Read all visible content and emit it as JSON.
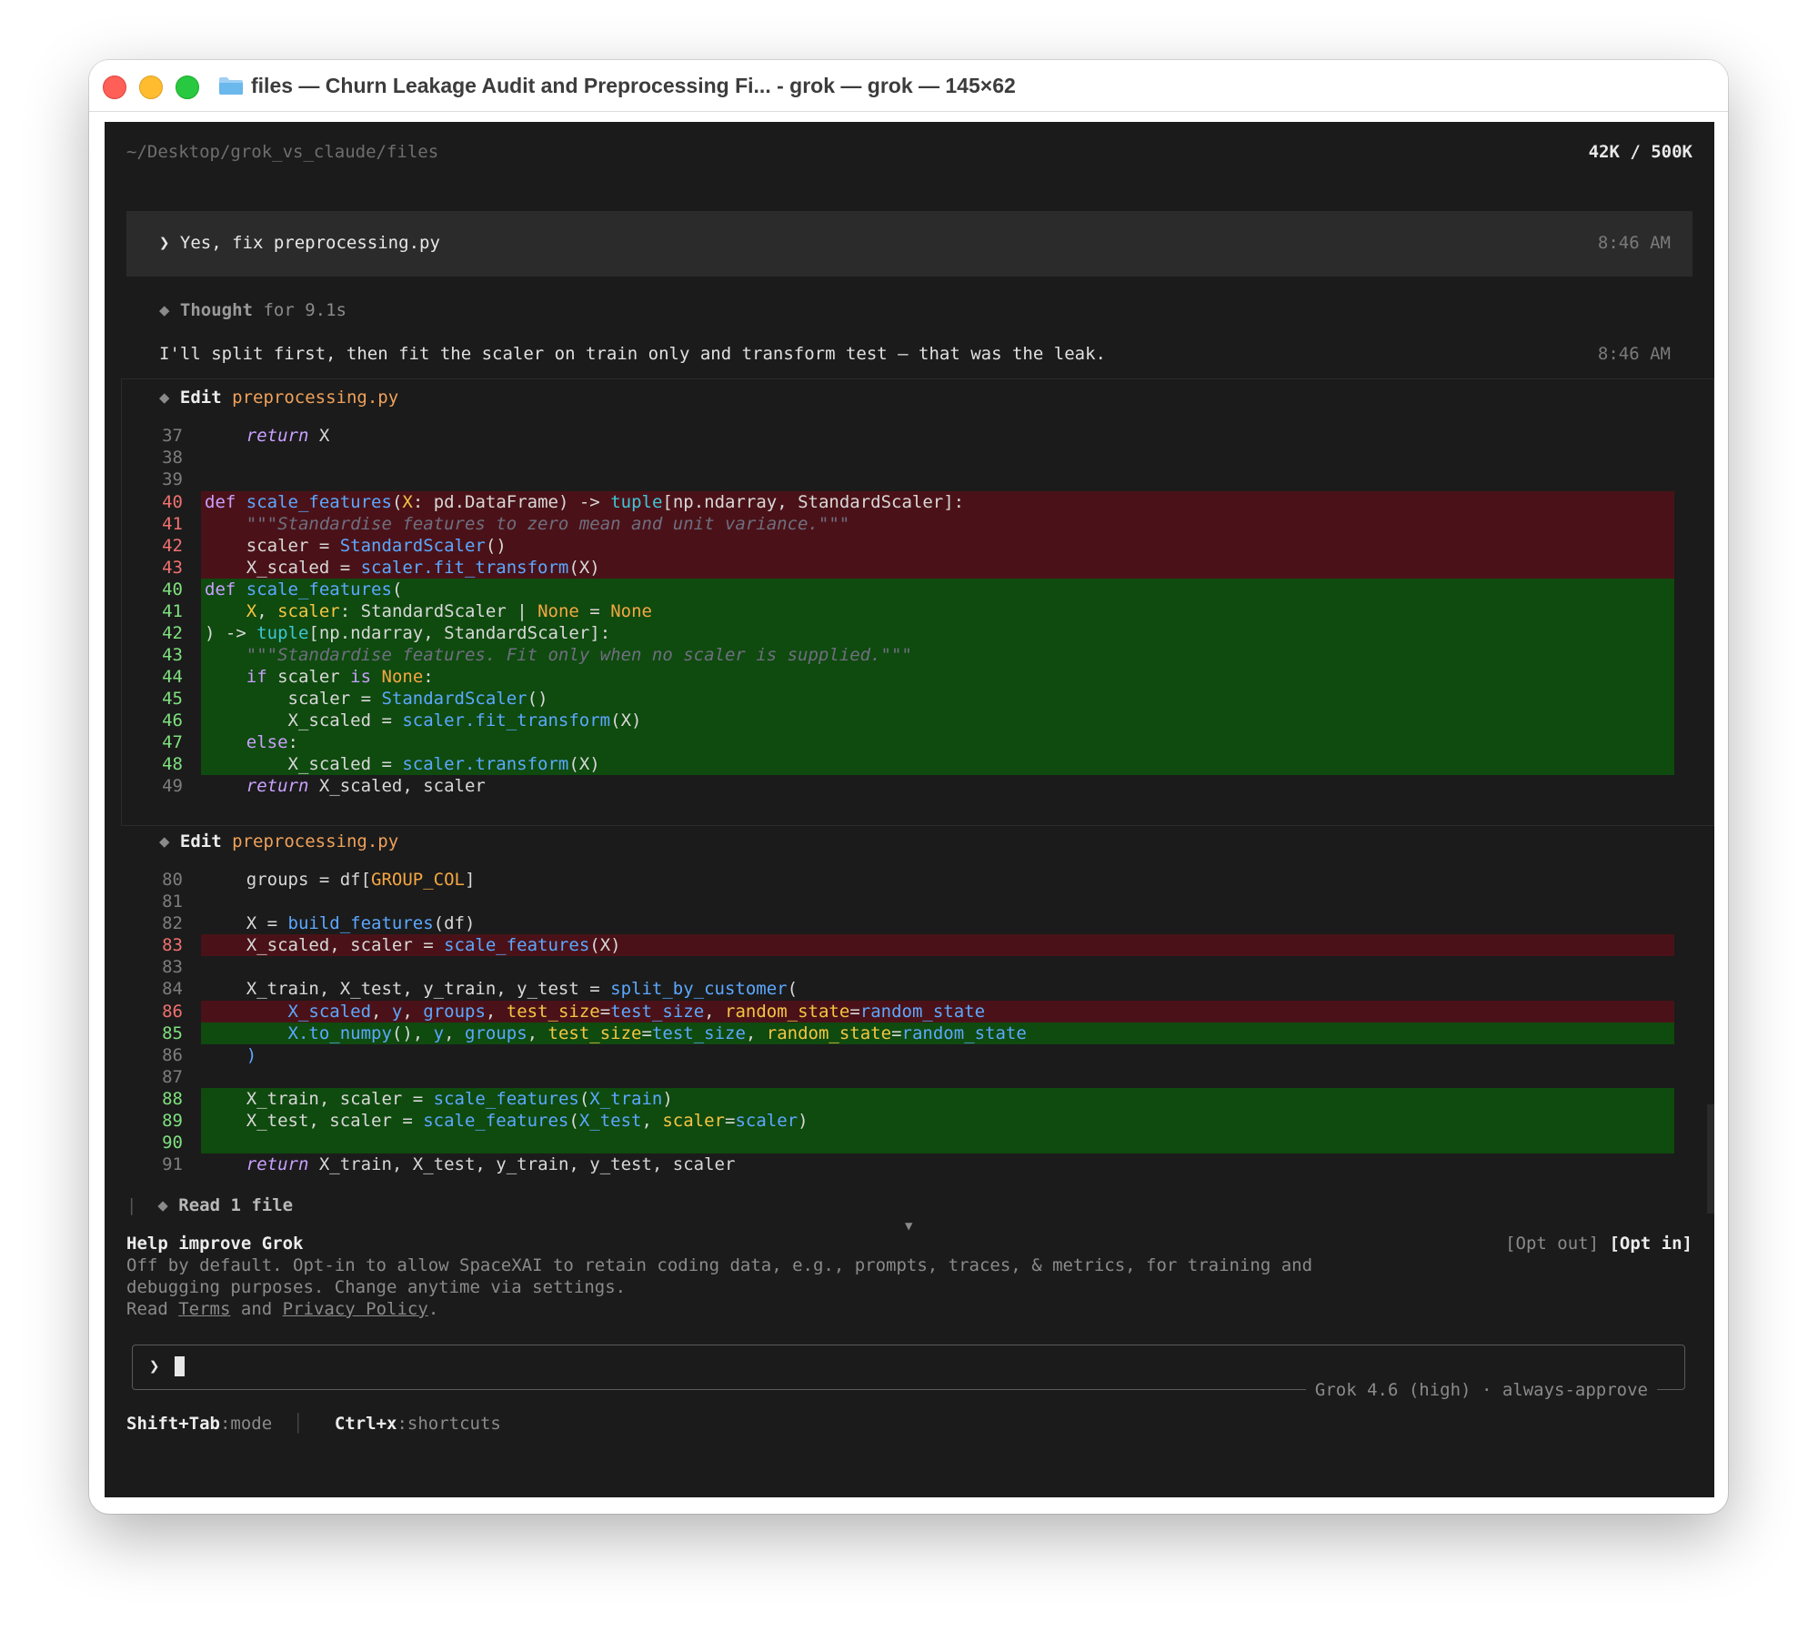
{
  "window": {
    "title": "files — Churn Leakage Audit and Preprocessing Fi... - grok — grok — 145×62"
  },
  "terminal": {
    "cwd": "~/Desktop/grok_vs_claude/files",
    "context_usage": "42K / 500K",
    "user_prompt": {
      "chevron": "❯",
      "text": "Yes, fix preprocessing.py",
      "time": "8:46 AM"
    },
    "thought": {
      "label": "Thought",
      "duration": "for 9.1s"
    },
    "assistant_message": {
      "text": "I'll split first, then fit the scaler on train only and transform test — that was the leak.",
      "time": "8:46 AM"
    },
    "edits": [
      {
        "action": "Edit",
        "file": "preprocessing.py"
      },
      {
        "action": "Edit",
        "file": "preprocessing.py"
      }
    ],
    "edit1_line_numbers": [
      "37",
      "38",
      "39",
      "40",
      "41",
      "42",
      "43",
      "40",
      "41",
      "42",
      "43",
      "44",
      "45",
      "46",
      "47",
      "48",
      "49"
    ],
    "edit2_line_numbers": [
      "80",
      "81",
      "82",
      "83",
      "83",
      "84",
      "86",
      "85",
      "86",
      "87",
      "88",
      "89",
      "90",
      "91"
    ],
    "read_files": {
      "label": "Read",
      "count_text": "1 file"
    },
    "help_banner": {
      "title": "Help improve Grok",
      "opt_out": "[Opt out]",
      "opt_in": "[Opt in]",
      "line1": "Off by default. Opt-in to allow SpaceXAI to retain coding data, e.g., prompts, traces, & metrics, for training and",
      "line2": "debugging purposes. Change anytime via settings.",
      "read_prefix": "Read",
      "terms": "Terms",
      "and": "and",
      "privacy": "Privacy Policy",
      "period": "."
    },
    "input": {
      "chevron": "❯",
      "value": "",
      "model": "Grok 4.6 (high)",
      "separator": "·",
      "approval_mode": "always-approve"
    },
    "footer": {
      "mode_key": "Shift+Tab",
      "mode_label": ":mode",
      "shortcuts_key": "Ctrl+x",
      "shortcuts_label": ":shortcuts"
    }
  },
  "colors": {
    "terminal_bg": "#1b1b1b",
    "deleted_line_bg": "#4a1218",
    "added_line_bg": "#0f4a0f",
    "filename_accent": "#f0a15a"
  }
}
